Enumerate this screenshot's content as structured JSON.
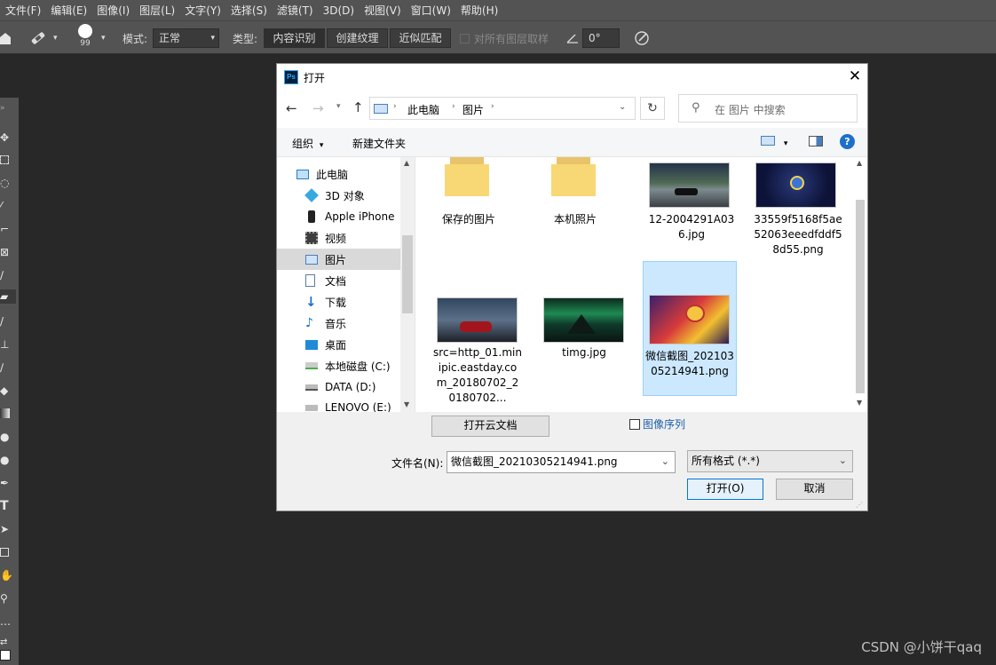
{
  "menu": [
    "文件(F)",
    "编辑(E)",
    "图像(I)",
    "图层(L)",
    "文字(Y)",
    "选择(S)",
    "滤镜(T)",
    "3D(D)",
    "视图(V)",
    "窗口(W)",
    "帮助(H)"
  ],
  "options": {
    "brush_size": "99",
    "mode_label": "模式:",
    "mode_value": "正常",
    "type_label": "类型:",
    "type_buttons": [
      "内容识别",
      "创建纹理",
      "近似匹配"
    ],
    "sample_all_label": "对所有图层取样",
    "angle_value": "0°"
  },
  "dialog": {
    "title": "打开",
    "breadcrumb": [
      "此电脑",
      "图片"
    ],
    "search_placeholder": "在 图片 中搜索",
    "organize_label": "组织",
    "new_folder_label": "新建文件夹",
    "nav_items": [
      "此电脑",
      "3D 对象",
      "Apple iPhone",
      "视频",
      "图片",
      "文档",
      "下载",
      "音乐",
      "桌面",
      "本地磁盘 (C:)",
      "DATA (D:)",
      "LENOVO (E:)"
    ],
    "files": [
      {
        "name": "保存的图片",
        "kind": "folder"
      },
      {
        "name": "本机照片",
        "kind": "folder"
      },
      {
        "name": "12-2004291A036.jpg",
        "kind": "image"
      },
      {
        "name": "33559f5168f5ae52063eeedfddf58d55.png",
        "kind": "image"
      },
      {
        "name": "src=http_01.minipic.eastday.com_20180702_20180702...",
        "kind": "image"
      },
      {
        "name": "timg.jpg",
        "kind": "image"
      },
      {
        "name": "微信截图_20210305214941.png",
        "kind": "image",
        "selected": true
      }
    ],
    "cloud_button": "打开云文档",
    "image_sequence_label": "图像序列",
    "filename_label": "文件名(N):",
    "filename_value": "微信截图_20210305214941.png",
    "filetype_value": "所有格式 (*.*)",
    "open_button": "打开(O)",
    "cancel_button": "取消"
  },
  "watermark": "CSDN @小饼干qaq",
  "colors": {
    "ps_bg": "#535353",
    "canvas": "#282828",
    "accent": "#0078d7",
    "selection": "#cce8ff"
  }
}
